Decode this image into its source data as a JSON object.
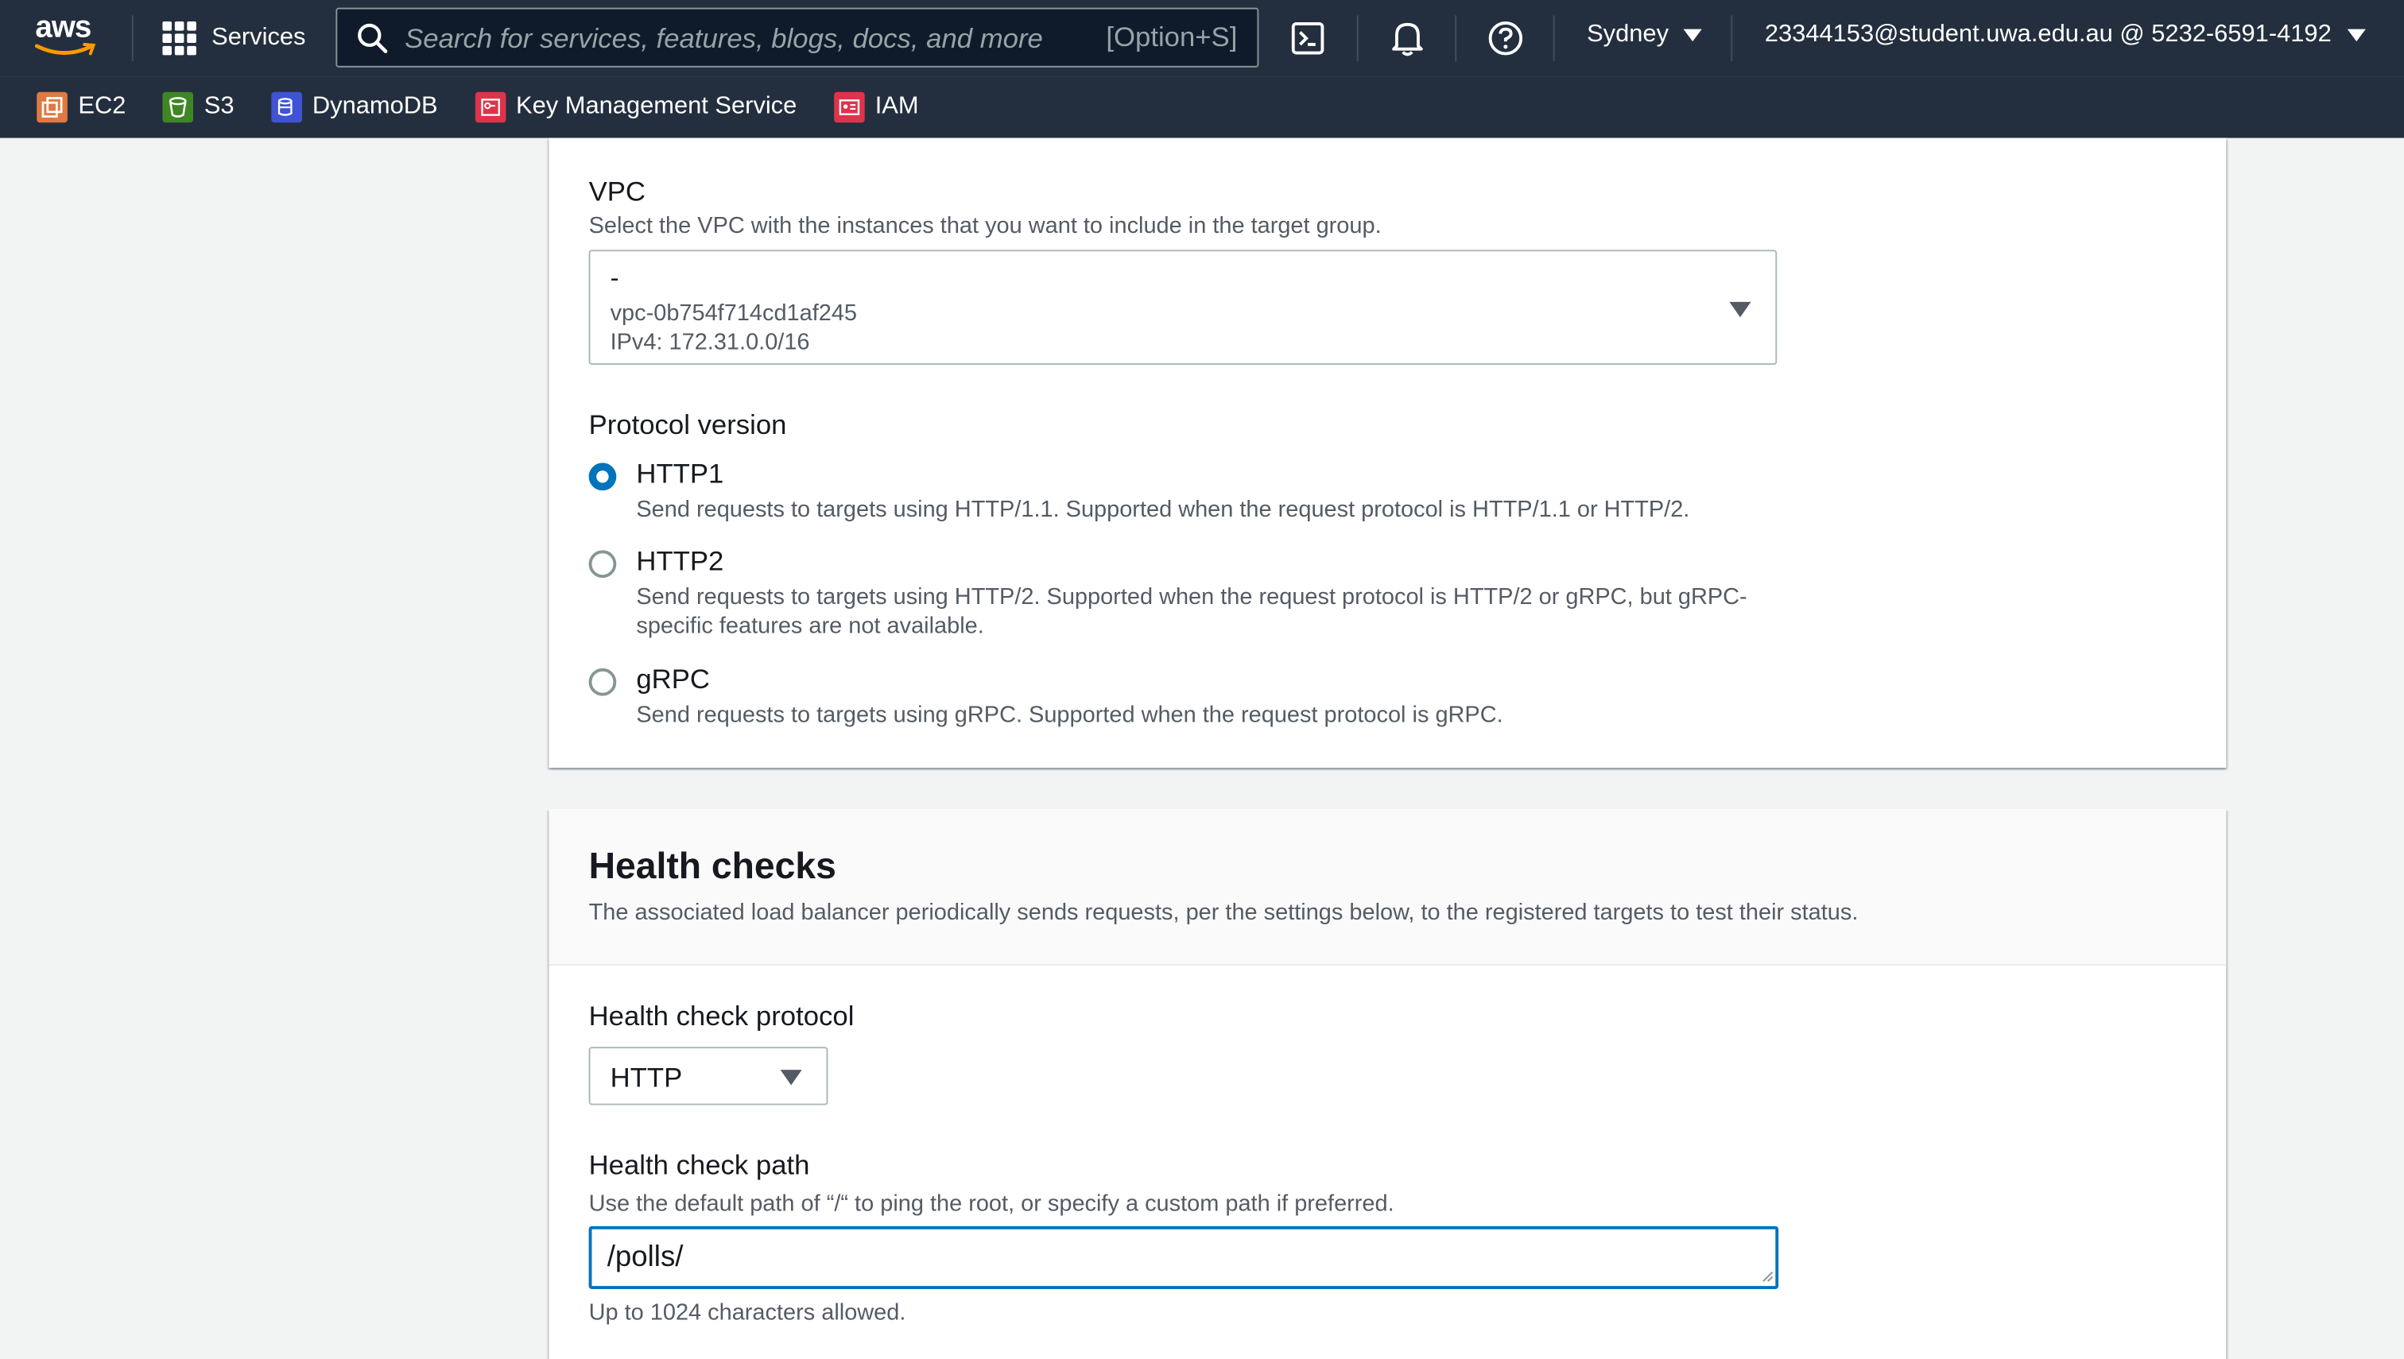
{
  "topbar": {
    "logo_text": "aws",
    "services_label": "Services",
    "search_placeholder": "Search for services, features, blogs, docs, and more",
    "search_shortcut": "[Option+S]",
    "region": "Sydney",
    "account": "23344153@student.uwa.edu.au @ 5232-6591-4192"
  },
  "favorites": [
    {
      "label": "EC2",
      "icon": "ec2-icon",
      "color": "#e07941"
    },
    {
      "label": "S3",
      "icon": "s3-icon",
      "color": "#3f8624"
    },
    {
      "label": "DynamoDB",
      "icon": "dynamodb-icon",
      "color": "#4053d6"
    },
    {
      "label": "Key Management Service",
      "icon": "kms-icon",
      "color": "#dd344c"
    },
    {
      "label": "IAM",
      "icon": "iam-icon",
      "color": "#dd344c"
    }
  ],
  "vpc": {
    "label": "VPC",
    "description": "Select the VPC with the instances that you want to include in the target group.",
    "selected_name": "-",
    "selected_id": "vpc-0b754f714cd1af245",
    "selected_cidr": "IPv4: 172.31.0.0/16"
  },
  "protocol_version": {
    "label": "Protocol version",
    "options": [
      {
        "title": "HTTP1",
        "desc": "Send requests to targets using HTTP/1.1. Supported when the request protocol is HTTP/1.1 or HTTP/2.",
        "checked": true
      },
      {
        "title": "HTTP2",
        "desc": "Send requests to targets using HTTP/2. Supported when the request protocol is HTTP/2 or gRPC, but gRPC-specific features are not available.",
        "checked": false
      },
      {
        "title": "gRPC",
        "desc": "Send requests to targets using gRPC. Supported when the request protocol is gRPC.",
        "checked": false
      }
    ]
  },
  "health_checks": {
    "title": "Health checks",
    "description": "The associated load balancer periodically sends requests, per the settings below, to the registered targets to test their status.",
    "protocol_label": "Health check protocol",
    "protocol_value": "HTTP",
    "path_label": "Health check path",
    "path_description": "Use the default path of “/“ to ping the root, or specify a custom path if preferred.",
    "path_value": "/polls/",
    "path_hint": "Up to 1024 characters allowed."
  },
  "colors": {
    "topbar": "#232f3e",
    "accent": "#0073bb"
  }
}
